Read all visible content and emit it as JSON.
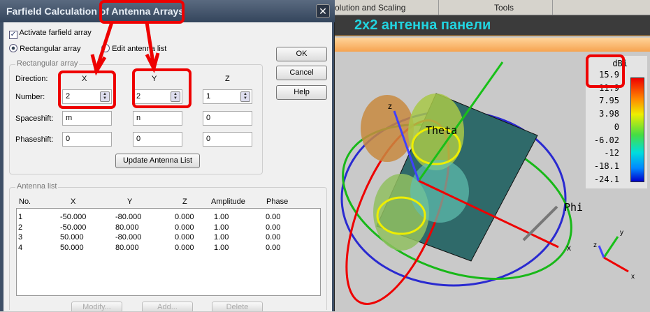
{
  "dialog": {
    "title": "Farfield Calculation of Antenna Arrays",
    "close": "✕",
    "activate_label": "Activate farfield array",
    "activate_checked": true,
    "radio_rect": "Rectangular array",
    "radio_edit": "Edit antenna list",
    "group_rect": "Rectangular array",
    "direction_label": "Direction:",
    "number_label": "Number:",
    "spaceshift_label": "Spaceshift:",
    "phaseshift_label": "Phaseshift:",
    "col_x": "X",
    "col_y": "Y",
    "col_z": "Z",
    "number": {
      "x": "2",
      "y": "2",
      "z": "1"
    },
    "spaceshift": {
      "x": "m",
      "y": "n",
      "z": "0"
    },
    "phaseshift": {
      "x": "0",
      "y": "0",
      "z": "0"
    },
    "update_btn": "Update Antenna List",
    "ok": "OK",
    "cancel": "Cancel",
    "help": "Help",
    "group_list": "Antenna list",
    "list_headers": [
      "No.",
      "X",
      "Y",
      "Z",
      "Amplitude",
      "Phase"
    ],
    "rows": [
      [
        "1",
        "-50.000",
        "-80.000",
        "0.000",
        "1.00",
        "0.00"
      ],
      [
        "2",
        "-50.000",
        "80.000",
        "0.000",
        "1.00",
        "0.00"
      ],
      [
        "3",
        "50.000",
        "-80.000",
        "0.000",
        "1.00",
        "0.00"
      ],
      [
        "4",
        "50.000",
        "80.000",
        "0.000",
        "1.00",
        "0.00"
      ]
    ],
    "modify": "Modify...",
    "add": "Add...",
    "delete": "Delete"
  },
  "app": {
    "menu_solution": "olution and Scaling",
    "menu_tools": "Tools",
    "banner": "2x2 антенна панели",
    "axis_theta": "Theta",
    "axis_phi": "Phi",
    "axis_z": "z",
    "axis_x": "x",
    "axis_y": "y",
    "legend_unit": "dBi",
    "legend_values": [
      "15.9",
      "11.9",
      "7.95",
      "3.98",
      "0",
      "-6.02",
      "-12",
      "-18.1",
      "-24.1"
    ]
  }
}
